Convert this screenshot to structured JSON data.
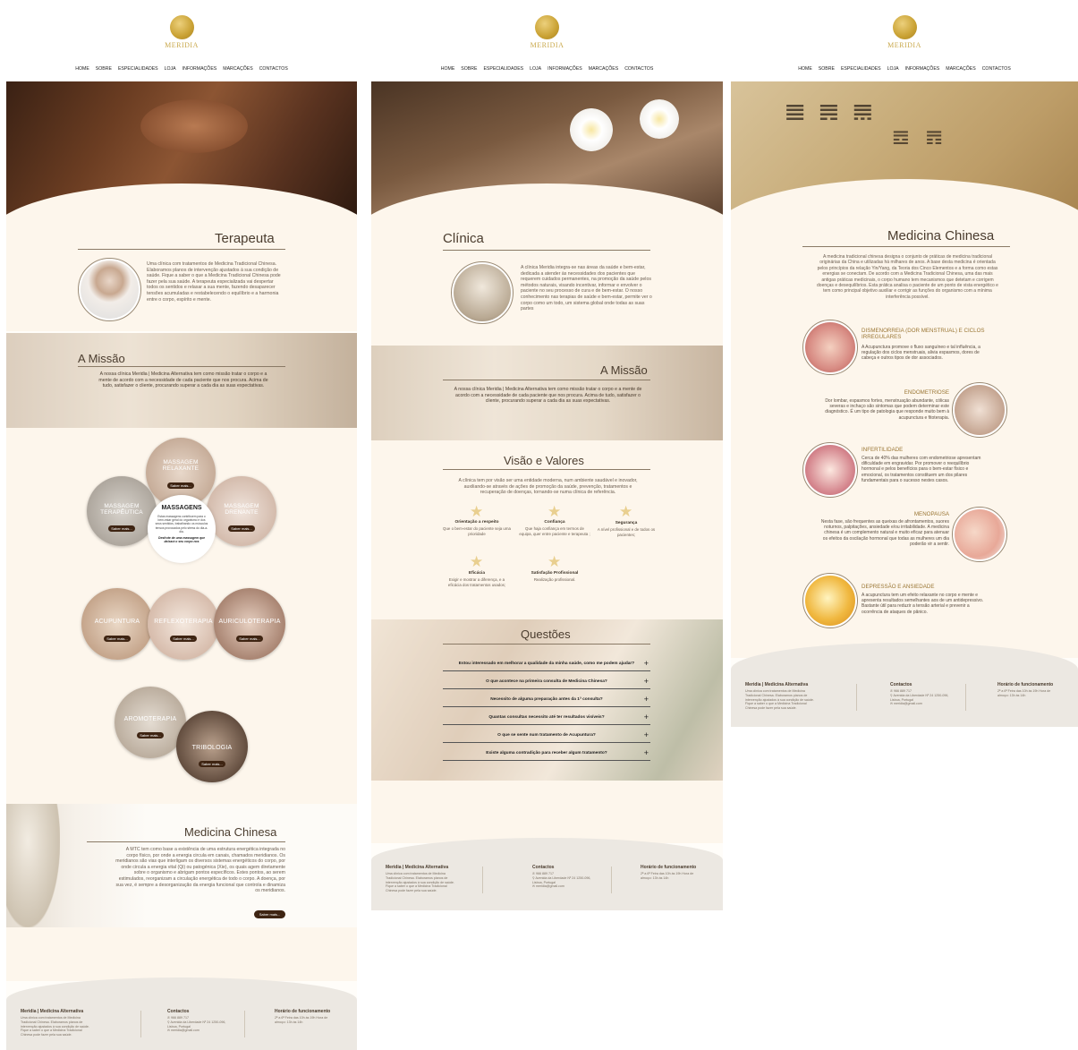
{
  "logo_text": "MERIDIA",
  "nav": [
    "HOME",
    "SOBRE",
    "ESPECIALIDADES",
    "LOJA",
    "INFORMAÇÕES",
    "MARCAÇÕES",
    "CONTACTOS"
  ],
  "page1": {
    "terapeuta_title": "Terapeuta",
    "terapeuta_text": "Uma clínica com tratamentos de Medicina Tradicional Chinesa. Elaboramos planos de intervenção ajustados à sua condição de saúde. Fique a saber o que a Medicina Tradicional Chinesa pode fazer pela sua saúde. A terapeuta especializada vai despertar todos os sentidos e relaxar a sua mente, fazendo desaparecer tensões acumuladas e restabelecendo o equilíbrio e a harmonia entre o corpo, espírito e mente.",
    "missao_title": "A Missão",
    "missao_text": "A nossa clínica Meridia | Medicina Alternativa tem como missão tratar o corpo e a mente de acordo com a necessidade de cada paciente que nos procura. Acima de tudo, satisfazer o cliente, procurando superar a cada dia as suas expectativas.",
    "massagens": {
      "title": "MASSAGENS",
      "text": "Estas massagens contribuem para o bem-estar geral do organismo e dos seus sentidos, trabalhando os músculos tensos provocados pelo stress do dia-a-dia.",
      "quote": "Desfrute de uma massagem que deixará o seu corpo nos",
      "relaxante": "MASSAGEM RELAXANTE",
      "terapeutica": "MASSAGEM TERAPÊUTICA",
      "drenante": "MASSAGEM DRENANTE"
    },
    "services": [
      "ACUPUNTURA",
      "REFLEXOTERAPIA",
      "AURICULOTERAPIA",
      "AROMOTERAPIA",
      "TRIBOLOGIA"
    ],
    "saber_mais": "Saber mais...",
    "mtc_title": "Medicina Chinesa",
    "mtc_text": "A MTC tem como base a existência de uma estrutura energética integrada no corpo físico, por onde a energia circula em canais, chamados meridianos. Os meridianos são vias que interligam os diversos sistemas energéticos do corpo, por onde circula a energia vital (Qi) ou patogénica (Xie), os quais agem diretamente sobre o organismo e abrigam pontos específicos. Estes pontos, ao serem estimulados, reorganizam a circulação energética de todo o corpo. A doença, por sua vez, é sempre a desorganização da energia funcional que controla e dinamiza os meridianos."
  },
  "page2": {
    "clinica_title": "Clínica",
    "clinica_text": "A clínica Meridia integra-se nas áreas da saúde e bem-estar, dedicada a atender às necessidades dos pacientes que requerem cuidados permanentes, na promoção da saúde pelos métodos naturais, visando incentivar, informar e envolver o paciente no seu processo de cura e de bem-estar. O nosso conhecimento nas terapias de saúde e bem-estar, permite ver o corpo como um todo, um sistema global onde todas as suas partes",
    "missao_title": "A Missão",
    "missao_text": "A nossa clínica Meridia | Medicina Alternativa tem como missão tratar o corpo e a mente de acordo com a necessidade de cada paciente que nos procura. Acima de tudo, satisfazer o cliente, procurando superar a cada dia as suas expectativas.",
    "visao_title": "Visão e Valores",
    "visao_text": "A clínica tem por visão ser uma entidade moderna, num ambiente saudável e inovador, auxiliando-se através de ações de promoção da saúde, prevenção, tratamentos e recuperação de doenças, tornando-se numa clínica de referência.",
    "values": [
      {
        "title": "Orientação a respeito",
        "text": "Que o bem-estar do paciente seja uma prioridade"
      },
      {
        "title": "Confiança",
        "text": "Que haja confiança em termos de equipa, quer entre paciente e terapeuta ;"
      },
      {
        "title": "Segurança",
        "text": "A nível profissional e de todos os pacientes;"
      },
      {
        "title": "Eficácia",
        "text": "Exigir e mostrar a diferença, e a eficácia dos tratamentos usados;"
      },
      {
        "title": "Satisfação Profissional",
        "text": "Realização profissional."
      }
    ],
    "questoes_title": "Questões",
    "questions": [
      "Estou interessado em melhorar a qualidade da minha saúde, como me podem ajudar?",
      "O que acontece na primeira consulta de Medicina Chinesa?",
      "Necessito de alguma preparação antes da 1ª consulta?",
      "Quantas consultas necessito até ter resultados visíveis?",
      "O que se sente num tratamento de Acupuntura?",
      "Existe alguma contradição para receber algum tratamento?"
    ]
  },
  "page3": {
    "title": "Medicina Chinesa",
    "intro": "A medicina tradicional chinesa designa o conjunto de práticas de medicina tradicional originárias da China e utilizadas há milhares de anos. A base desta medicina é orientada pelos princípios da relação Yin/Yang, da Teoria dos Cinco Elementos e a forma como estas energias se conectam. De acordo com a Medicina Tradicional Chinesa, uma das mais antigas práticas medicinais, o corpo humano tem mecanismos que detetam e corrigem doenças e desequilíbrios. Esta prática analisa o paciente de um ponto de vista energético e tem como principal objetivo auxiliar e corrigir as funções do organismo com a mínima interferência possível.",
    "items": [
      {
        "title": "DISMENORREIA (DOR MENSTRUAL) E CICLOS IRREGULARES",
        "text": "A Acupunctura promove o fluxo sanguíneo e tal influência, a regulação dos ciclos menstruais, alivia espasmos, dores de cabeça e outros tipos de dor associados."
      },
      {
        "title": "ENDOMETRIOSE",
        "text": "Dor lombar, espasmos fortes, menstruação abundante, cólicas severas e inchaço são sintomas que podem determinar este diagnóstico. É um tipo de patologia que responde muito bem à acupunctura e fitoterapia."
      },
      {
        "title": "INFERTILIDADE",
        "text": "Cerca de 40% das mulheres com endometriose apresentam dificuldade em engravidar. Por promover o reequilíbrio hormonal e pelos benefícios para o bem-estar físico e emocional, os tratamentos constituem um dos pilares fundamentais para o sucesso nestes casos."
      },
      {
        "title": "MENOPAUSA",
        "text": "Nesta fase, são frequentes as queixas de afrontamentos, suores noturnos, palpitações, ansiedade e/ou irritabilidade. A medicina chinesa é um complemento natural e muito eficaz para atenuar os efeitos da oscilação hormonal que todas as mulheres um dia poderão vir a sentir."
      },
      {
        "title": "DEPRESSÃO E ANSIEDADE",
        "text": "A acupunctura tem um efeito relaxante no corpo e mente e apresenta resultados semelhantes aos de um antidepressivo. Bastante útil para reduzir a tensão arterial e prevenir a ocorrência de ataques de pânico."
      }
    ]
  },
  "footer": {
    "brand": "Meridia | Medicina Alternativa",
    "brand_text": "Uma clínica com tratamentos de Medicina Tradicional Chinesa. Elaboramos planos de intervenção ajustados à sua condição de saúde. Fique a saber o que a Medicina Tradicional Chinesa pode fazer pela sua saúde.",
    "contactos": "Contactos",
    "phone": "966 889 717",
    "address": "Avenida da Liberdade Nº 24 1250-096, Lisboa, Portugal",
    "email": "meridia@gmail.com",
    "horario": "Horário de funcionamento",
    "horario_text": "2ª a 6ª Feira das 10h às 19h Hora de almoço: 13h às 14h"
  },
  "colors": {
    "accent": "#c9a133",
    "dark_button": "#3e2412",
    "cream": "#fdf6ec",
    "footer": "#ece8e2"
  }
}
